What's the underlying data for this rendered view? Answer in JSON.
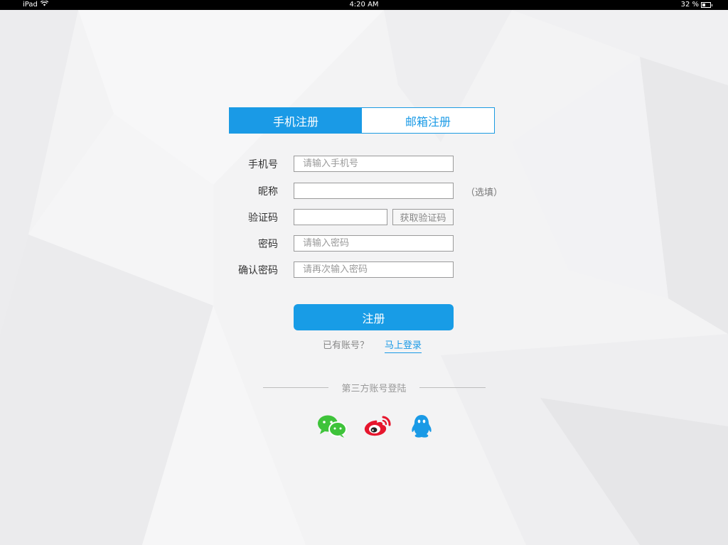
{
  "status_bar": {
    "device": "iPad",
    "time": "4:20 AM",
    "battery": "32 %"
  },
  "tabs": [
    {
      "label": "手机注册",
      "active": true
    },
    {
      "label": "邮箱注册",
      "active": false
    }
  ],
  "form": {
    "phone": {
      "label": "手机号",
      "placeholder": "请输入手机号",
      "value": ""
    },
    "nickname": {
      "label": "昵称",
      "placeholder": "",
      "value": "",
      "hint": "（选填）"
    },
    "code": {
      "label": "验证码",
      "placeholder": "",
      "value": "",
      "button": "获取验证码"
    },
    "password": {
      "label": "密码",
      "placeholder": "请输入密码",
      "value": ""
    },
    "confirm": {
      "label": "确认密码",
      "placeholder": "请再次输入密码",
      "value": ""
    }
  },
  "submit_label": "注册",
  "login_prompt": {
    "text": "已有账号？",
    "link": "马上登录"
  },
  "third_party": {
    "label": "第三方账号登陆",
    "providers": [
      "wechat-icon",
      "weibo-icon",
      "qq-icon"
    ]
  },
  "colors": {
    "accent": "#1a9ae6",
    "wechat": "#3ec33a",
    "weibo": "#e6162d",
    "qq": "#1a9ae6"
  }
}
